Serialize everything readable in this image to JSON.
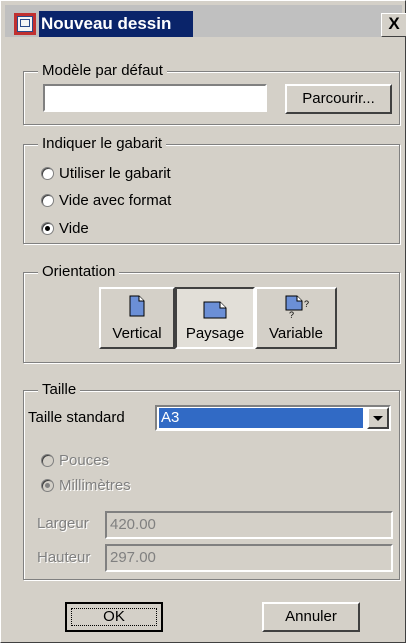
{
  "window": {
    "title": "Nouveau dessin",
    "close_label": "X"
  },
  "template_group": {
    "legend": "Modèle par défaut",
    "input_value": "",
    "browse_label": "Parcourir..."
  },
  "gabarit_group": {
    "legend": "Indiquer le gabarit",
    "options": [
      {
        "label": "Utiliser le gabarit",
        "checked": false
      },
      {
        "label": "Vide avec format",
        "checked": false
      },
      {
        "label": "Vide",
        "checked": true
      }
    ]
  },
  "orientation_group": {
    "legend": "Orientation",
    "buttons": [
      {
        "label": "Vertical",
        "icon": "portrait-page-icon",
        "pressed": false
      },
      {
        "label": "Paysage",
        "icon": "landscape-page-icon",
        "pressed": true
      },
      {
        "label": "Variable",
        "icon": "variable-page-icon",
        "pressed": false
      }
    ]
  },
  "size_group": {
    "legend": "Taille",
    "standard_label": "Taille standard",
    "standard_value": "A3",
    "units": [
      {
        "label": "Pouces",
        "checked": false,
        "enabled": false
      },
      {
        "label": "Millimètres",
        "checked": true,
        "enabled": false
      }
    ],
    "width_label": "Largeur",
    "width_value": "420.00",
    "height_label": "Hauteur",
    "height_value": "297.00"
  },
  "footer": {
    "ok_label": "OK",
    "cancel_label": "Annuler"
  },
  "colors": {
    "face": "#d4d0c8",
    "title_bg": "#0a246a",
    "selection": "#316ac5",
    "icon_fill": "#6b8fd6"
  }
}
